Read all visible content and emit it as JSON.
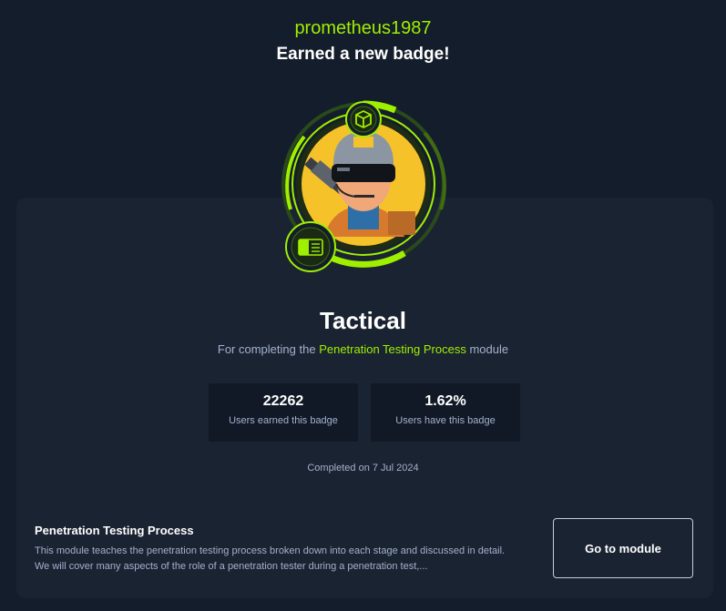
{
  "header": {
    "username": "prometheus1987",
    "headline": "Earned a new badge!"
  },
  "badge": {
    "name": "Tactical",
    "subtitle_prefix": "For completing the",
    "module_name": "Penetration Testing Process",
    "subtitle_suffix": "module",
    "icons": [
      "cube-icon",
      "module-card-icon",
      "soldier-avatar"
    ]
  },
  "stats": [
    {
      "value": "22262",
      "label": "Users earned this badge"
    },
    {
      "value": "1.62%",
      "label": "Users have this badge"
    }
  ],
  "completed": "Completed on 7 Jul 2024",
  "module": {
    "title": "Penetration Testing Process",
    "description": "This module teaches the penetration testing process broken down into each stage and discussed in detail. We will cover many aspects of the role of a penetration tester during a penetration test,...",
    "button_label": "Go to module"
  },
  "colors": {
    "background": "#141d2b",
    "card": "#1a2332",
    "accent": "#9fef00",
    "stat_box": "#111927",
    "muted_text": "#a4b1cd"
  }
}
